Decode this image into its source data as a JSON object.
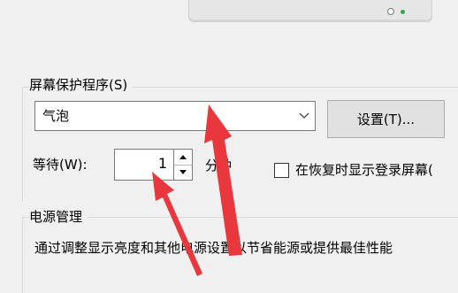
{
  "screen_saver": {
    "group_title": "屏幕保护程序(S)",
    "selected_option": "气泡",
    "settings_button": "设置(T)...",
    "wait_label": "等待(W):",
    "wait_value": "1",
    "minute_unit": "分钟",
    "resume_checkbox_label": "在恢复时显示登录屏幕(",
    "resume_checkbox_checked": false
  },
  "power": {
    "group_title": "电源管理",
    "description": "通过调整显示亮度和其他电源设置以节省能源或提供最佳性能"
  },
  "colors": {
    "annotation_arrow": "#e8383d",
    "button_face": "#e1e1e1",
    "window_background": "#f0f0f0",
    "power_led": "#2fa84f"
  },
  "icons": {
    "dropdown": "chevron-down-icon",
    "spinner_up": "triangle-up-icon",
    "spinner_down": "triangle-down-icon",
    "annotation": "red-arrow-icon"
  }
}
